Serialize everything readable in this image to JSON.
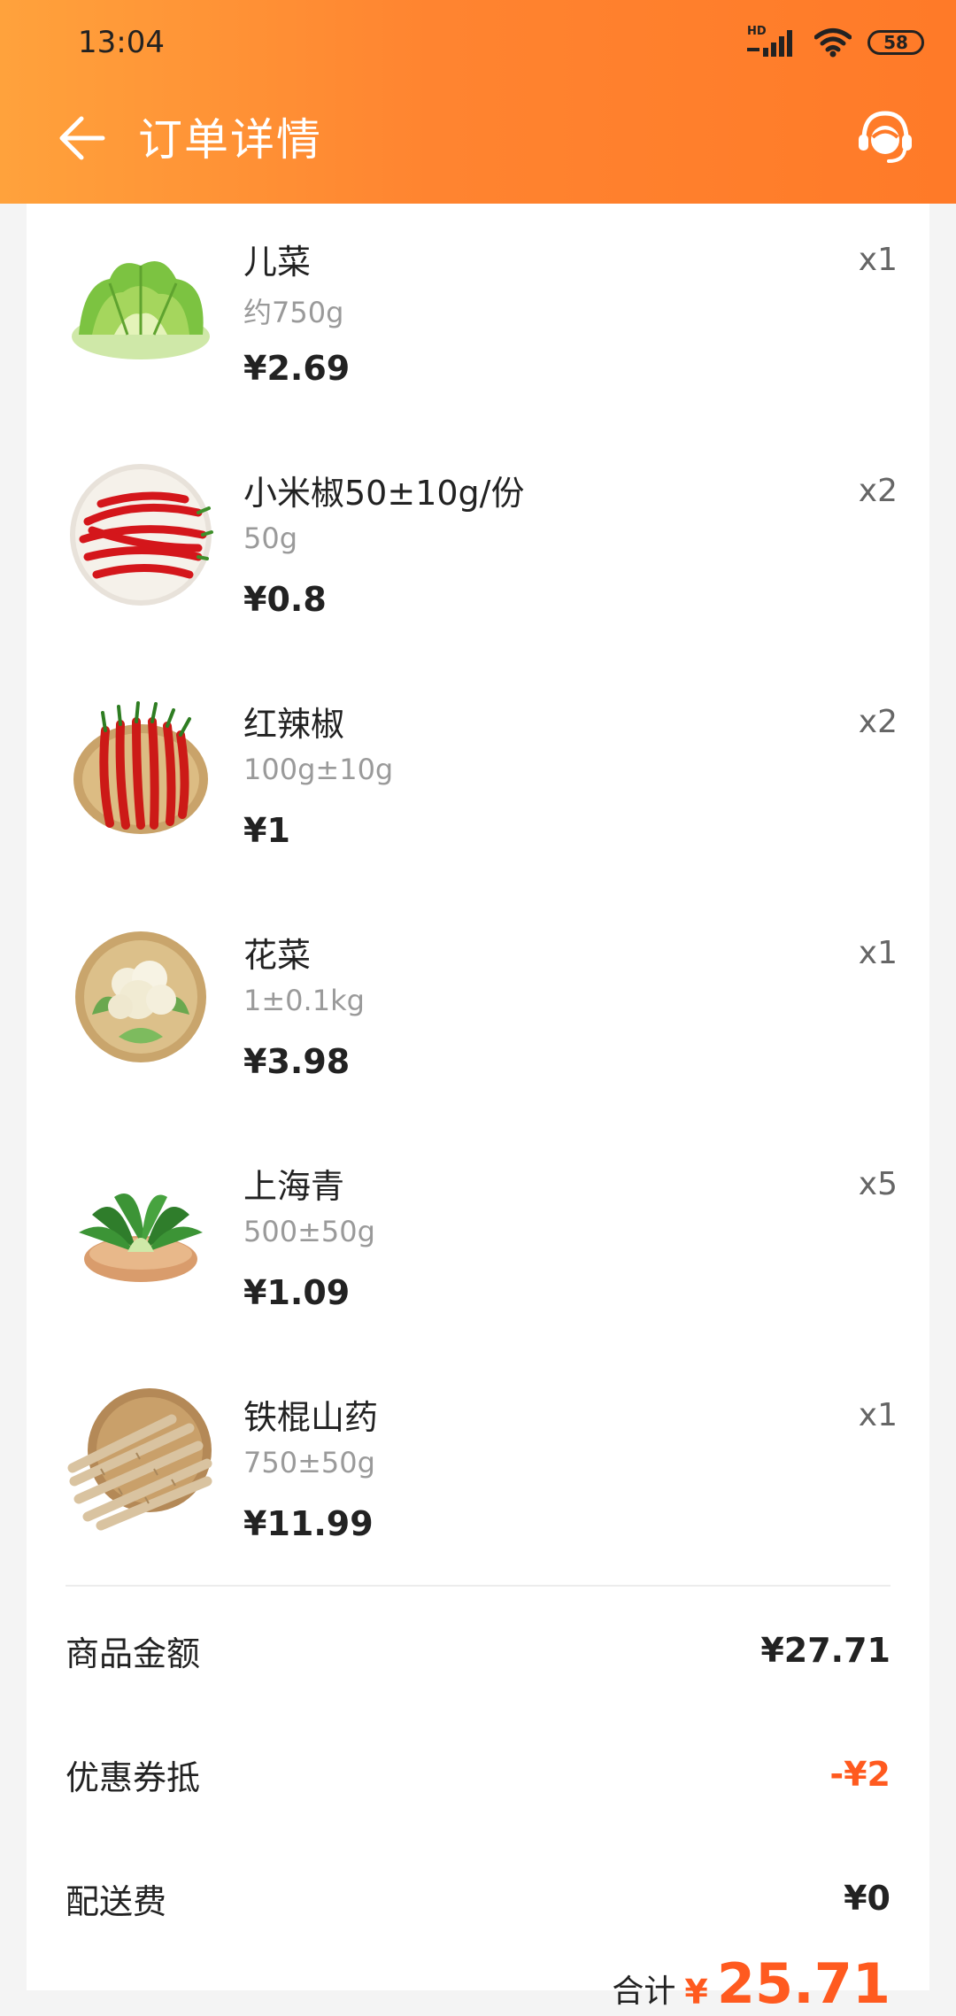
{
  "status_bar": {
    "time": "13:04",
    "hd": "HD",
    "battery": "58"
  },
  "header": {
    "title": "订单详情",
    "icons": {
      "back": "back-arrow-icon",
      "service": "customer-service-icon"
    }
  },
  "items": [
    {
      "name": "儿菜",
      "spec": "约750g",
      "price": "¥2.69",
      "qty": "x1",
      "image": "greens-leaf-image"
    },
    {
      "name": "小米椒50±10g/份",
      "spec": "50g",
      "price": "¥0.8",
      "qty": "x2",
      "image": "red-chili-plate-image"
    },
    {
      "name": "红辣椒",
      "spec": "100g±10g",
      "price": "¥1",
      "qty": "x2",
      "image": "red-peppers-basket-image"
    },
    {
      "name": "花菜",
      "spec": "1±0.1kg",
      "price": "¥3.98",
      "qty": "x1",
      "image": "cauliflower-basket-image"
    },
    {
      "name": "上海青",
      "spec": "500±50g",
      "price": "¥1.09",
      "qty": "x5",
      "image": "bok-choy-bowl-image"
    },
    {
      "name": "铁棍山药",
      "spec": "750±50g",
      "price": "¥11.99",
      "qty": "x1",
      "image": "yam-basket-image"
    }
  ],
  "summary": {
    "goods_amount": {
      "label": "商品金额",
      "value": "¥27.71"
    },
    "coupon": {
      "label": "优惠券抵",
      "value": "-¥2"
    },
    "delivery": {
      "label": "配送费",
      "value": "¥0"
    }
  },
  "total": {
    "label": "合计",
    "currency": "¥",
    "value": "25.71"
  },
  "colors": {
    "accent": "#ff7a28",
    "price_red": "#ff5a1f"
  }
}
